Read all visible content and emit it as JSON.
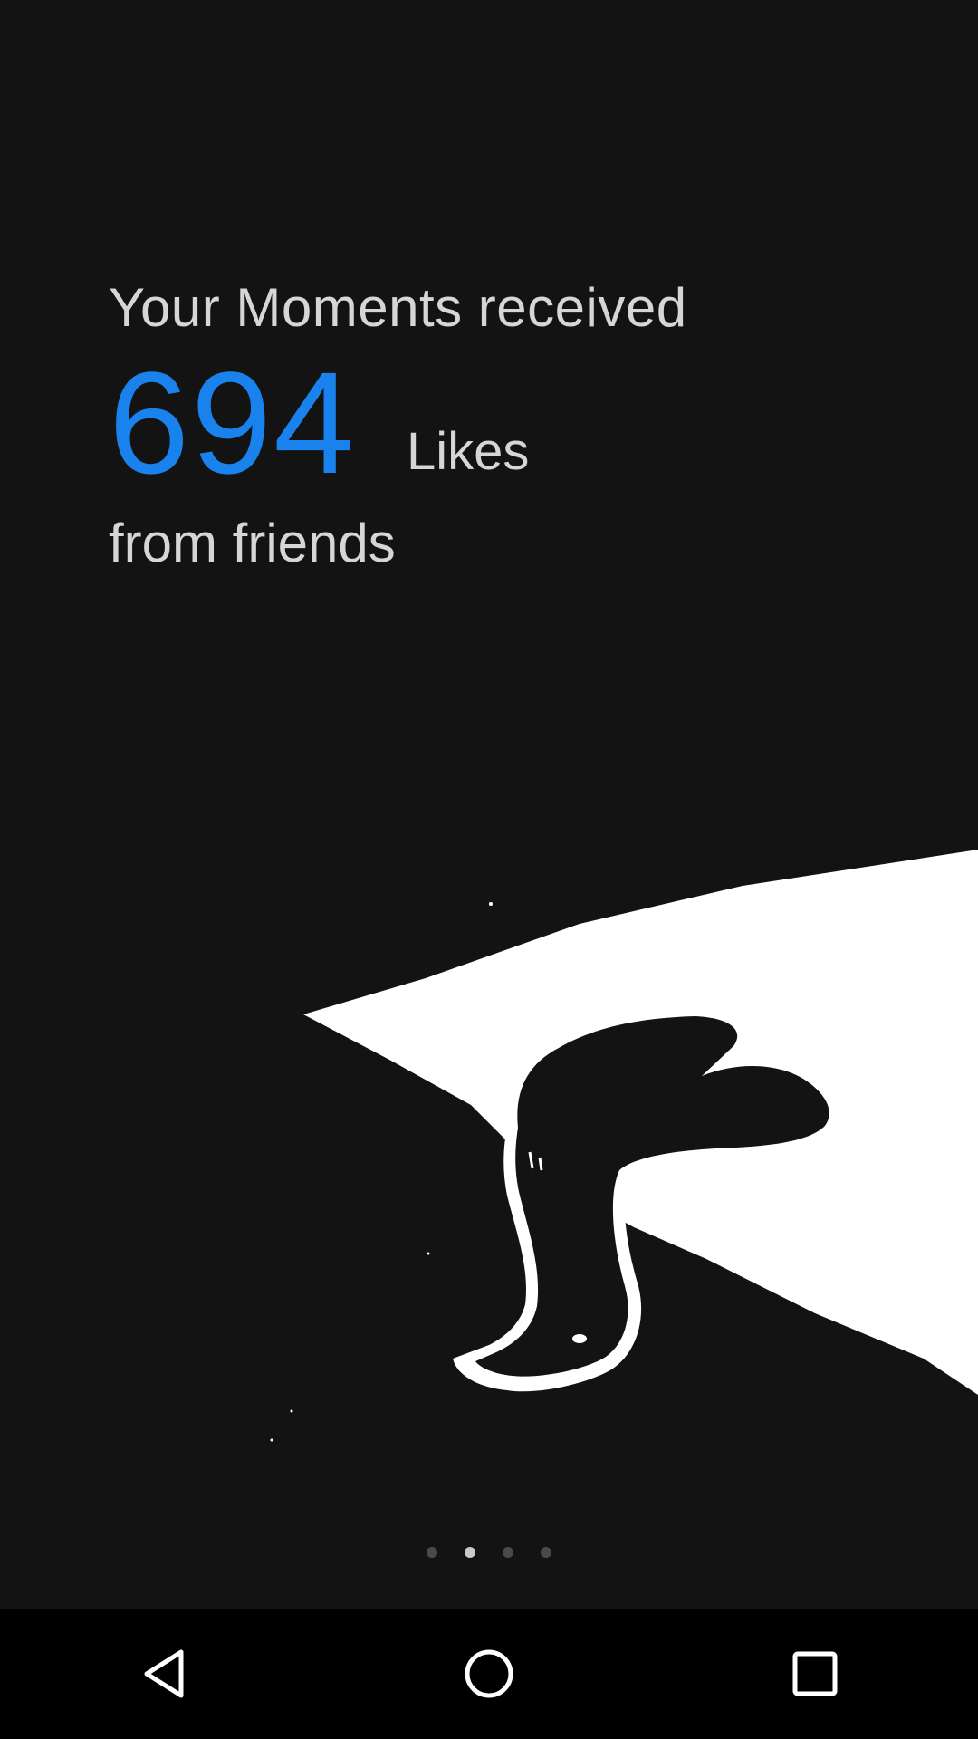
{
  "summary": {
    "intro": "Your Moments received",
    "count": "694",
    "unit": "Likes",
    "outro": "from friends"
  },
  "colors": {
    "background": "#131314",
    "accent": "#1a82ec",
    "text": "#d6d6d6"
  },
  "pager": {
    "total": 4,
    "active_index": 1
  },
  "navbar": {
    "buttons": [
      "back-icon",
      "home-icon",
      "recents-icon"
    ]
  }
}
